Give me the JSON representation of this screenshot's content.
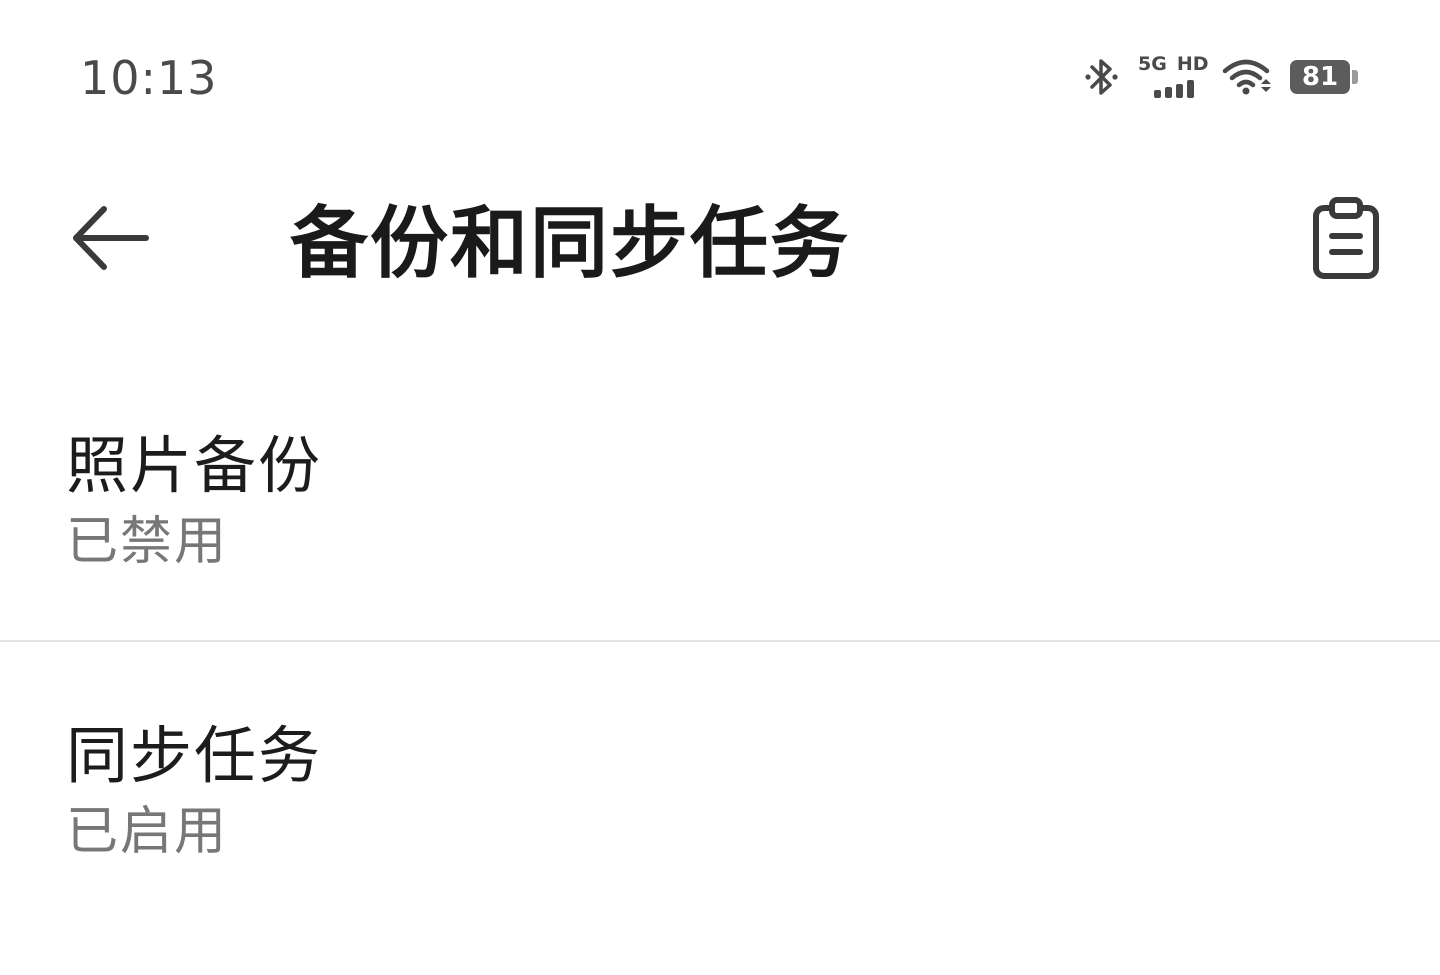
{
  "status_bar": {
    "time": "10:13",
    "network_type": "5G",
    "network_hd": "HD",
    "battery_level": "81",
    "icons": [
      "bluetooth-icon",
      "cellular-signal-icon",
      "wifi-icon",
      "battery-icon"
    ]
  },
  "app_bar": {
    "title": "备份和同步任务",
    "back_icon": "arrow-left-icon",
    "action_icon": "clipboard-icon"
  },
  "settings": {
    "items": [
      {
        "title": "照片备份",
        "status": "已禁用"
      },
      {
        "title": "同步任务",
        "status": "已启用"
      }
    ]
  },
  "colors": {
    "background": "#ffffff",
    "title_text": "#1a1a1a",
    "secondary_text": "#777777",
    "status_text": "#4a4a4a",
    "divider": "#e2e2e2"
  }
}
